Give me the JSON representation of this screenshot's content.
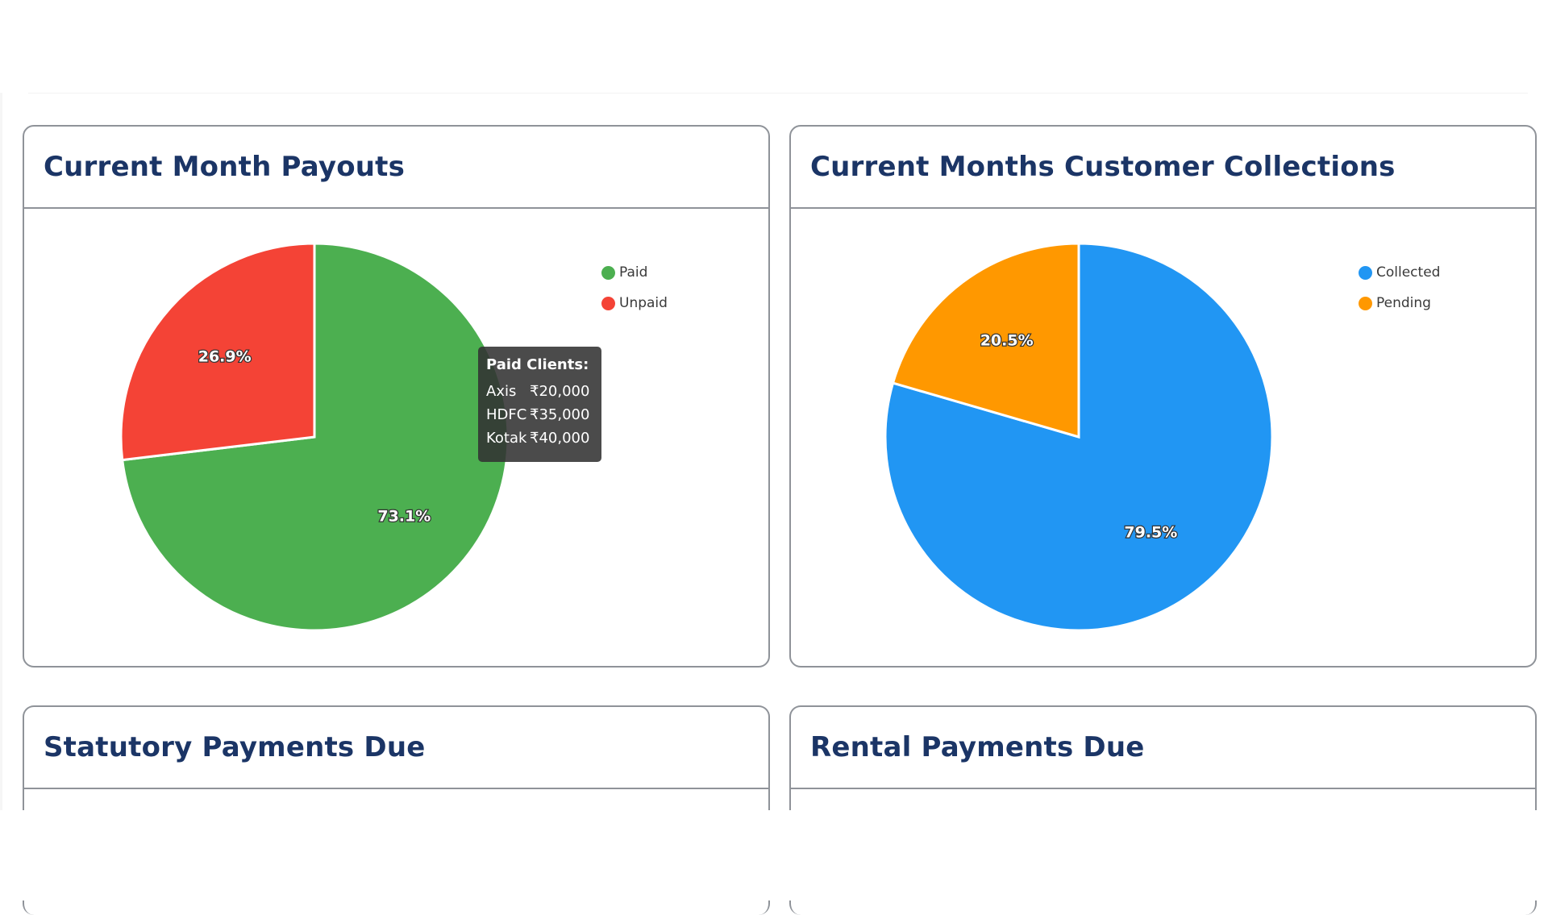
{
  "cards": {
    "payouts": {
      "title": "Current Month Payouts"
    },
    "collections": {
      "title": "Current Months Customer Collections"
    },
    "statutory": {
      "title": "Statutory Payments Due"
    },
    "rental": {
      "title": "Rental Payments Due"
    }
  },
  "tooltip": {
    "title": "Paid Clients:",
    "rows": [
      {
        "name": "Axis",
        "value": "₹20,000"
      },
      {
        "name": "HDFC",
        "value": "₹35,000"
      },
      {
        "name": "Kotak",
        "value": "₹40,000"
      }
    ]
  },
  "chart_data": [
    {
      "type": "pie",
      "title": "Current Month Payouts",
      "legend_position": "top-right",
      "slices": [
        {
          "name": "Paid",
          "value": 73.1,
          "label": "73.1%",
          "color": "#4caf50"
        },
        {
          "name": "Unpaid",
          "value": 26.9,
          "label": "26.9%",
          "color": "#f44336"
        }
      ]
    },
    {
      "type": "pie",
      "title": "Current Months Customer Collections",
      "legend_position": "top-right",
      "slices": [
        {
          "name": "Collected",
          "value": 79.5,
          "label": "79.5%",
          "color": "#2196f3"
        },
        {
          "name": "Pending",
          "value": 20.5,
          "label": "20.5%",
          "color": "#ff9800"
        }
      ]
    }
  ]
}
